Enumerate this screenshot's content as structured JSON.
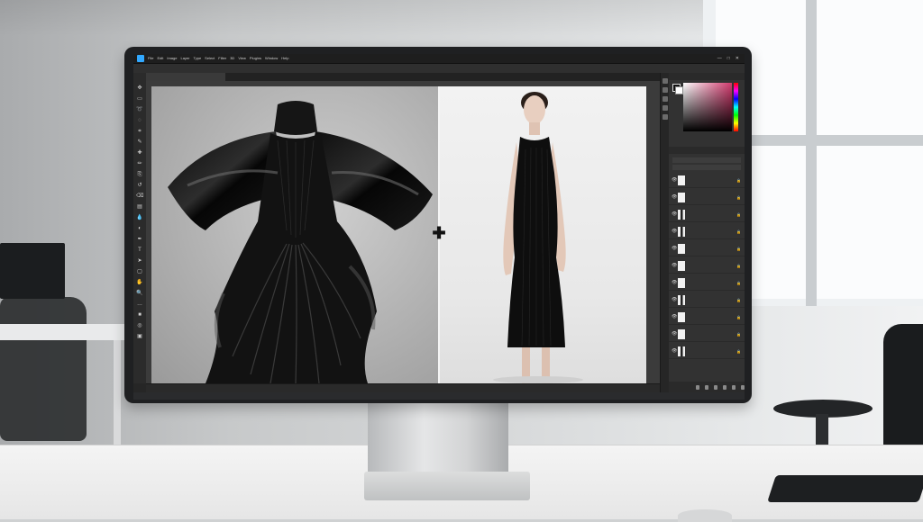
{
  "app": {
    "menu": [
      "File",
      "Edit",
      "Image",
      "Layer",
      "Type",
      "Select",
      "Filter",
      "3D",
      "View",
      "Plugins",
      "Window",
      "Help"
    ],
    "doc_title": "",
    "window_controls": [
      "—",
      "□",
      "✕"
    ]
  },
  "tabs": [],
  "status": {
    "zoom": ""
  },
  "tools": [
    "move-tool",
    "marquee-tool",
    "lasso-tool",
    "quick-select-tool",
    "crop-tool",
    "eyedropper-tool",
    "healing-tool",
    "brush-tool",
    "clone-stamp-tool",
    "history-brush-tool",
    "eraser-tool",
    "gradient-tool",
    "blur-tool",
    "dodge-tool",
    "pen-tool",
    "type-tool",
    "path-select-tool",
    "shape-tool",
    "hand-tool",
    "zoom-tool",
    "more-tools-icon",
    "color-swatch-tool",
    "quick-mask-tool",
    "screen-mode-tool"
  ],
  "panels": {
    "color_title": "",
    "layers_title": "",
    "layer_filter": "",
    "layer_blend": "",
    "layers": [
      {
        "name": "",
        "thumb": "white"
      },
      {
        "name": "",
        "thumb": "white"
      },
      {
        "name": "",
        "thumb": "dark"
      },
      {
        "name": "",
        "thumb": "dark"
      },
      {
        "name": "",
        "thumb": "white"
      },
      {
        "name": "",
        "thumb": "white"
      },
      {
        "name": "",
        "thumb": "white"
      },
      {
        "name": "",
        "thumb": "dark"
      },
      {
        "name": "",
        "thumb": "white"
      },
      {
        "name": "",
        "thumb": "white"
      },
      {
        "name": "",
        "thumb": "dark"
      }
    ]
  },
  "colors": {
    "accent": "#31a8ff",
    "foreground": "#111111",
    "background": "#ffffff"
  },
  "glyphs": {
    "eye": "👁",
    "lock": "🔒",
    "split_handle": "✚"
  }
}
